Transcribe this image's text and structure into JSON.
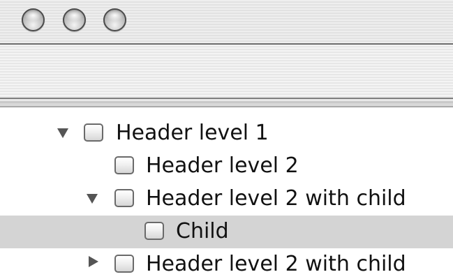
{
  "window": {
    "buttons": [
      {
        "name": "close",
        "icon": "graphite-close-icon"
      },
      {
        "name": "minimize",
        "icon": "graphite-minimize-icon"
      },
      {
        "name": "zoom",
        "icon": "graphite-zoom-icon"
      }
    ]
  },
  "outline": {
    "rows": [
      {
        "label": "Header level 1",
        "level": 1,
        "disclosure": "expanded",
        "checked": false,
        "selected": false
      },
      {
        "label": "Header level 2",
        "level": 2,
        "disclosure": "none",
        "checked": false,
        "selected": false
      },
      {
        "label": "Header level 2 with child",
        "level": 2,
        "disclosure": "expanded",
        "checked": false,
        "selected": false
      },
      {
        "label": "Child",
        "level": 3,
        "disclosure": "none",
        "checked": false,
        "selected": true
      },
      {
        "label": "Header level 2 with child",
        "level": 2,
        "disclosure": "collapsed",
        "checked": false,
        "selected": false
      }
    ]
  },
  "colors": {
    "selection": "#d4d4d4",
    "text": "#111111",
    "disclosure": "#555555"
  }
}
